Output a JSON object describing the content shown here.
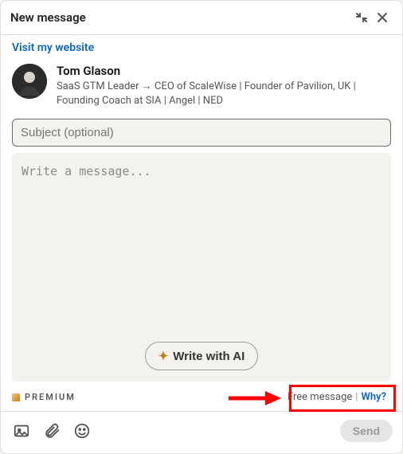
{
  "header": {
    "title": "New message"
  },
  "visit_link": "Visit my website",
  "recipient": {
    "name": "Tom Glason",
    "subtitle": "SaaS GTM Leader → CEO of ScaleWise | Founder of Pavilion, UK | Founding Coach at SIA | Angel | NED"
  },
  "subject_placeholder": "Subject (optional)",
  "message_placeholder": "Write a message...",
  "ai_button": "Write with AI",
  "premium_badge": "PREMIUM",
  "free_message": "Free message",
  "separator": "|",
  "why": "Why?",
  "send_label": "Send"
}
